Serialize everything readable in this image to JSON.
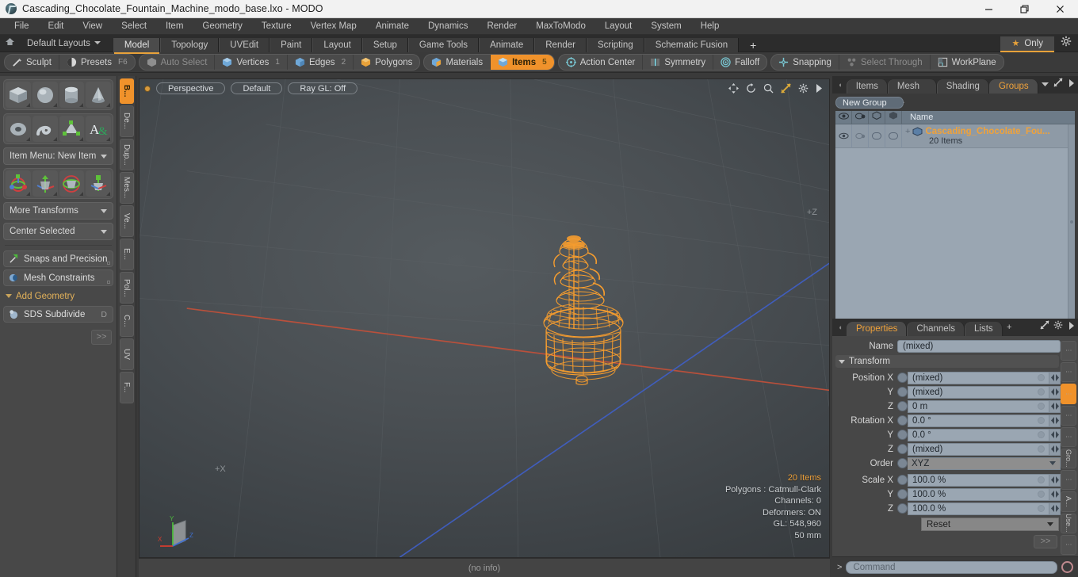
{
  "titlebar": {
    "title": "Cascading_Chocolate_Fountain_Machine_modo_base.lxo - MODO",
    "app_icon": "modo-logo-icon",
    "minimize": "minimize-icon",
    "maximize": "restore-icon",
    "close": "close-icon"
  },
  "menubar": {
    "items": [
      "File",
      "Edit",
      "View",
      "Select",
      "Item",
      "Geometry",
      "Texture",
      "Vertex Map",
      "Animate",
      "Dynamics",
      "Render",
      "MaxToModo",
      "Layout",
      "System",
      "Help"
    ]
  },
  "layoutbar": {
    "home_icon": "home-icon",
    "default_layouts": "Default Layouts",
    "tabs": [
      "Model",
      "Topology",
      "UVEdit",
      "Paint",
      "Layout",
      "Setup",
      "Game Tools",
      "Animate",
      "Render",
      "Scripting",
      "Schematic Fusion"
    ],
    "active_tab": "Model",
    "add_tab": "+",
    "only_label": "Only",
    "star_icon": "star-icon",
    "gear_icon": "gear-icon"
  },
  "toolbar": {
    "group1": [
      {
        "label": "Sculpt",
        "icon": "sculpt-icon",
        "state": "normal",
        "num": ""
      },
      {
        "label": "Presets",
        "icon": "presets-icon",
        "state": "normal",
        "num": "F6"
      }
    ],
    "group2": [
      {
        "label": "Auto Select",
        "icon": "cube-gray-icon",
        "state": "dim",
        "num": ""
      },
      {
        "label": "Vertices",
        "icon": "cube-vertex-icon",
        "state": "normal",
        "num": "1"
      },
      {
        "label": "Edges",
        "icon": "cube-edge-icon",
        "state": "normal",
        "num": "2"
      },
      {
        "label": "Polygons",
        "icon": "cube-poly-icon",
        "state": "normal",
        "num": ""
      }
    ],
    "group3": [
      {
        "label": "Materials",
        "icon": "cube-material-icon",
        "state": "normal",
        "num": ""
      },
      {
        "label": "Items",
        "icon": "cube-items-icon",
        "state": "selected",
        "num": "5"
      }
    ],
    "group4": [
      {
        "label": "Action Center",
        "icon": "action-center-icon",
        "state": "normal",
        "num": ""
      },
      {
        "label": "Symmetry",
        "icon": "symmetry-icon",
        "state": "normal",
        "num": ""
      },
      {
        "label": "Falloff",
        "icon": "falloff-icon",
        "state": "normal",
        "num": ""
      }
    ],
    "group5": [
      {
        "label": "Snapping",
        "icon": "snapping-icon",
        "state": "normal",
        "num": ""
      },
      {
        "label": "Select Through",
        "icon": "select-through-icon",
        "state": "dim",
        "num": ""
      },
      {
        "label": "WorkPlane",
        "icon": "workplane-icon",
        "state": "normal",
        "num": ""
      }
    ]
  },
  "leftpanel": {
    "primitives_row1": [
      "cube-icon",
      "sphere-icon",
      "cylinder-icon",
      "cone-icon"
    ],
    "primitives_row2": [
      "torus-icon",
      "spiral-icon",
      "vertex-mesh-icon",
      "text-icon"
    ],
    "item_menu": "Item Menu: New Item",
    "transforms_row": [
      "move-transform-icon",
      "translate-transform-icon",
      "rotate-transform-icon",
      "scale-transform-icon"
    ],
    "more_transforms": "More Transforms",
    "center_selected": "Center Selected",
    "snaps_precision": "Snaps and Precision",
    "mesh_constraints": "Mesh Constraints",
    "add_geometry": "Add Geometry",
    "sds_subdivide": "SDS Subdivide",
    "sds_key": "D",
    "more_button": ">>",
    "vtabs": [
      {
        "label": "B...",
        "active": true
      },
      {
        "label": "De...",
        "active": false
      },
      {
        "label": "Dup...",
        "active": false
      },
      {
        "label": "Mes...",
        "active": false
      },
      {
        "label": "Ve...",
        "active": false
      },
      {
        "label": "E...",
        "active": false
      },
      {
        "label": "Pol...",
        "active": false
      },
      {
        "label": "C...",
        "active": false
      },
      {
        "label": "UV",
        "active": false
      },
      {
        "label": "F...",
        "active": false
      }
    ]
  },
  "viewport": {
    "view_mode": "Perspective",
    "shading": "Default",
    "ray_gl": "Ray GL: Off",
    "icons": [
      "move-view-icon",
      "rotate-view-icon",
      "zoom-view-icon",
      "fit-view-icon",
      "viewport-gear-icon",
      "viewport-more-icon"
    ],
    "axis_plus_x": "+X",
    "axis_plus_z": "+Z",
    "info": {
      "items": "20 Items",
      "polygons": "Polygons : Catmull-Clark",
      "channels": "Channels: 0",
      "deformers": "Deformers: ON",
      "gl": "GL: 548,960",
      "grid": "50 mm"
    },
    "gizmo_labels": [
      "X",
      "Y",
      "Z"
    ],
    "model_name": "chocolate-fountain-wireframe",
    "wireframe_color": "#f79d2e",
    "axis_x_color": "#c0482f",
    "axis_z_color": "#3f5fc0"
  },
  "statusbar": {
    "text": "(no info)"
  },
  "rightpanel": {
    "top_tabs": [
      "Items",
      "Mesh ...",
      "Shading",
      "Groups"
    ],
    "top_active": "Groups",
    "tab_dropdown_icon": "chevron-down-icon",
    "expand_icon": "expand-icon",
    "more_icon": "more-icon",
    "new_group_button": "New Group",
    "list_columns": [
      "eye-icon",
      "render-icon",
      "wire-icon",
      "shade-icon",
      "Name"
    ],
    "rows": [
      {
        "name": "Cascading_Chocolate_Fou...",
        "subtitle": "20 Items",
        "expand": "+",
        "item_icon": "group-cube-icon"
      }
    ]
  },
  "properties": {
    "tabs": [
      "Properties",
      "Channels",
      "Lists"
    ],
    "active_tab": "Properties",
    "add_tab": "+",
    "expand_icon": "expand-icon",
    "gear_icon": "gear-icon",
    "more_icon": "more-icon",
    "name_label": "Name",
    "name_value": "(mixed)",
    "transform_header": "Transform",
    "fields": [
      {
        "label": "Position X",
        "value": "(mixed)"
      },
      {
        "label": "Y",
        "value": "(mixed)"
      },
      {
        "label": "Z",
        "value": "0 m"
      },
      {
        "label": "Rotation X",
        "value": "0.0 °"
      },
      {
        "label": "Y",
        "value": "0.0 °"
      },
      {
        "label": "Z",
        "value": "(mixed)"
      }
    ],
    "order_label": "Order",
    "order_value": "XYZ",
    "scale_fields": [
      {
        "label": "Scale X",
        "value": "100.0 %"
      },
      {
        "label": "Y",
        "value": "100.0 %"
      },
      {
        "label": "Z",
        "value": "100.0 %"
      }
    ],
    "reset_value": "Reset",
    "go_button": ">>",
    "vtabs": [
      {
        "label": "⋮",
        "active": false
      },
      {
        "label": "⋮",
        "active": false
      },
      {
        "label": "⋮",
        "active": true
      },
      {
        "label": "⋮",
        "active": false
      },
      {
        "label": "⋮",
        "active": false
      },
      {
        "label": "Gro...",
        "active": false
      },
      {
        "label": "⋮",
        "active": false
      },
      {
        "label": "A...",
        "active": false
      },
      {
        "label": "Use...",
        "active": false
      },
      {
        "label": "⋮",
        "active": false
      }
    ]
  },
  "commandbar": {
    "prompt": ">",
    "placeholder": "Command",
    "record_icon": "record-icon"
  }
}
